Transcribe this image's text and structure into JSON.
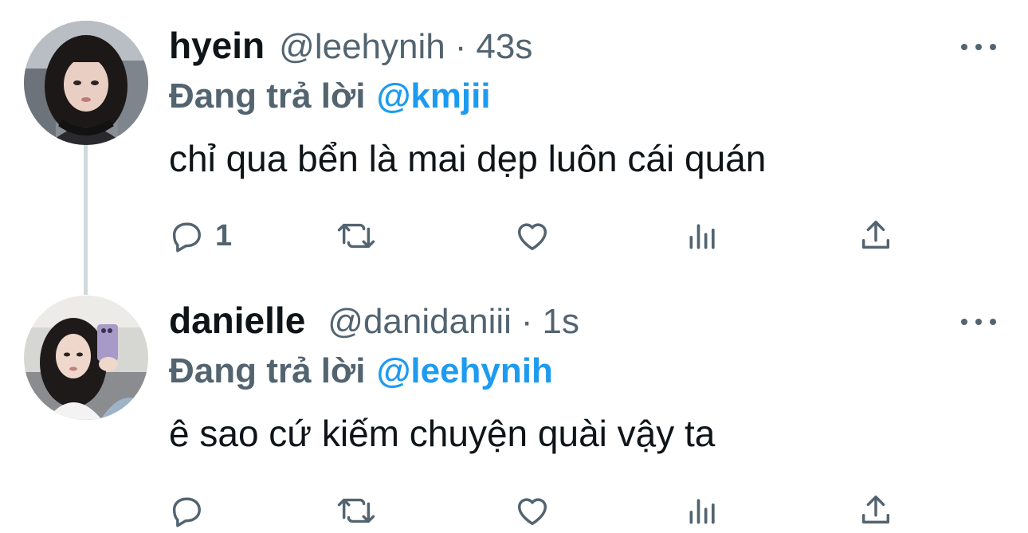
{
  "tweets": [
    {
      "display_name": "hyein",
      "handle": "@leehynih",
      "separator": "·",
      "time": "43s",
      "reply_prefix": "Đang trả lời",
      "reply_to": "@kmjii",
      "text": "chỉ qua bển là mai dẹp luôn cái quán",
      "reply_count": "1",
      "avatar_icon": "profile-photo-hyein"
    },
    {
      "display_name": "danielle",
      "handle": "@danidaniii",
      "separator": "·",
      "time": "1s",
      "reply_prefix": "Đang trả lời",
      "reply_to": "@leehynih",
      "text": "ê sao cứ kiếm chuyện quài vậy ta",
      "reply_count": "",
      "avatar_icon": "profile-photo-danielle"
    }
  ],
  "icons": {
    "reply": "reply-icon",
    "retweet": "retweet-icon",
    "like": "heart-icon",
    "views": "views-icon",
    "share": "share-icon",
    "more": "more-icon"
  },
  "colors": {
    "text_primary": "#0f1419",
    "text_secondary": "#536471",
    "mention": "#1d9bf0",
    "thread_line": "#cfd9de"
  }
}
